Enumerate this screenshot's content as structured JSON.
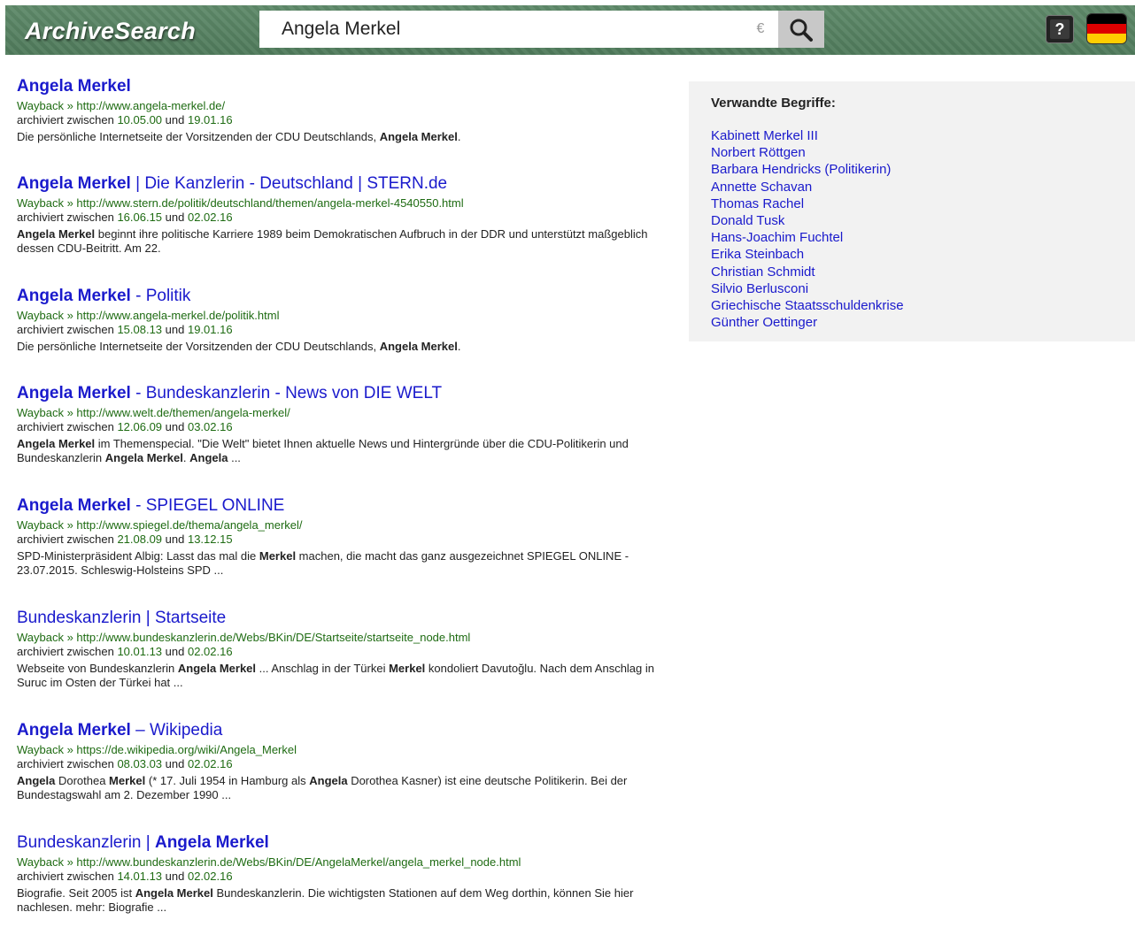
{
  "header": {
    "logo": "ArchiveSearch",
    "search_value": "Angela Merkel",
    "clear_glyph": "€",
    "help_label": "?",
    "icons": [
      "search-icon",
      "help-icon",
      "german-flag-icon"
    ],
    "flag_colors": [
      "#000000",
      "#dd0000",
      "#ffce00"
    ],
    "accent_color": "#55806a"
  },
  "results": [
    {
      "title": [
        {
          "t": "Angela Merkel",
          "b": true
        }
      ],
      "url": "Wayback » http://www.angela-merkel.de/",
      "archived_prefix": "archiviert zwischen ",
      "from": "10.05.00",
      "mid": " und ",
      "to": "19.01.16",
      "snippet": [
        {
          "t": "Die persönliche Internetseite der Vorsitzenden der CDU Deutschlands, "
        },
        {
          "t": "Angela Merkel",
          "b": true
        },
        {
          "t": "."
        }
      ]
    },
    {
      "title": [
        {
          "t": "Angela Merkel",
          "b": true
        },
        {
          "t": " | Die Kanzlerin - Deutschland | STERN.de"
        }
      ],
      "url": "Wayback » http://www.stern.de/politik/deutschland/themen/angela-merkel-4540550.html",
      "archived_prefix": "archiviert zwischen ",
      "from": "16.06.15",
      "mid": " und ",
      "to": "02.02.16",
      "snippet": [
        {
          "t": "Angela Merkel",
          "b": true
        },
        {
          "t": " beginnt ihre politische Karriere 1989 beim Demokratischen Aufbruch in der DDR und unterstützt maßgeblich dessen CDU-Beitritt. Am 22."
        }
      ]
    },
    {
      "title": [
        {
          "t": "Angela Merkel",
          "b": true
        },
        {
          "t": " - Politik"
        }
      ],
      "url": "Wayback » http://www.angela-merkel.de/politik.html",
      "archived_prefix": "archiviert zwischen ",
      "from": "15.08.13",
      "mid": " und ",
      "to": "19.01.16",
      "snippet": [
        {
          "t": "Die persönliche Internetseite der Vorsitzenden der CDU Deutschlands, "
        },
        {
          "t": "Angela Merkel",
          "b": true
        },
        {
          "t": "."
        }
      ]
    },
    {
      "title": [
        {
          "t": "Angela Merkel",
          "b": true
        },
        {
          "t": " - Bundeskanzlerin - News von DIE WELT"
        }
      ],
      "url": "Wayback » http://www.welt.de/themen/angela-merkel/",
      "archived_prefix": "archiviert zwischen ",
      "from": "12.06.09",
      "mid": " und ",
      "to": "03.02.16",
      "snippet": [
        {
          "t": "Angela Merkel",
          "b": true
        },
        {
          "t": " im Themenspecial. \"Die Welt\" bietet Ihnen aktuelle News und Hintergründe über die CDU-Politikerin und Bundeskanzlerin "
        },
        {
          "t": "Angela Merkel",
          "b": true
        },
        {
          "t": ". "
        },
        {
          "t": "Angela",
          "b": true
        },
        {
          "t": " ..."
        }
      ]
    },
    {
      "title": [
        {
          "t": "Angela Merkel",
          "b": true
        },
        {
          "t": " - SPIEGEL ONLINE"
        }
      ],
      "url": "Wayback » http://www.spiegel.de/thema/angela_merkel/",
      "archived_prefix": "archiviert zwischen ",
      "from": "21.08.09",
      "mid": " und ",
      "to": "13.12.15",
      "snippet": [
        {
          "t": "SPD-Ministerpräsident Albig: Lasst das mal die "
        },
        {
          "t": "Merkel",
          "b": true
        },
        {
          "t": " machen, die macht das ganz ausgezeichnet SPIEGEL ONLINE - 23.07.2015. Schleswig-Holsteins SPD ..."
        }
      ]
    },
    {
      "title": [
        {
          "t": "Bundeskanzlerin | Startseite"
        }
      ],
      "url": "Wayback » http://www.bundeskanzlerin.de/Webs/BKin/DE/Startseite/startseite_node.html",
      "archived_prefix": "archiviert zwischen ",
      "from": "10.01.13",
      "mid": " und ",
      "to": "02.02.16",
      "snippet": [
        {
          "t": "Webseite von Bundeskanzlerin "
        },
        {
          "t": "Angela Merkel",
          "b": true
        },
        {
          "t": " ... Anschlag in der Türkei "
        },
        {
          "t": "Merkel",
          "b": true
        },
        {
          "t": " kondoliert Davutoğlu. Nach dem Anschlag in Suruc im Osten der Türkei hat ..."
        }
      ]
    },
    {
      "title": [
        {
          "t": "Angela Merkel",
          "b": true
        },
        {
          "t": " – Wikipedia"
        }
      ],
      "url": "Wayback » https://de.wikipedia.org/wiki/Angela_Merkel",
      "archived_prefix": "archiviert zwischen ",
      "from": "08.03.03",
      "mid": " und ",
      "to": "02.02.16",
      "snippet": [
        {
          "t": "Angela",
          "b": true
        },
        {
          "t": " Dorothea "
        },
        {
          "t": "Merkel",
          "b": true
        },
        {
          "t": " (* 17. Juli 1954 in Hamburg als "
        },
        {
          "t": "Angela",
          "b": true
        },
        {
          "t": " Dorothea Kasner) ist eine deutsche Politikerin. Bei der Bundestagswahl am 2. Dezember 1990 ..."
        }
      ]
    },
    {
      "title": [
        {
          "t": "Bundeskanzlerin | "
        },
        {
          "t": "Angela Merkel",
          "b": true
        }
      ],
      "url": "Wayback » http://www.bundeskanzlerin.de/Webs/BKin/DE/AngelaMerkel/angela_merkel_node.html",
      "archived_prefix": "archiviert zwischen ",
      "from": "14.01.13",
      "mid": " und ",
      "to": "02.02.16",
      "snippet": [
        {
          "t": "Biografie. Seit 2005 ist "
        },
        {
          "t": "Angela Merkel",
          "b": true
        },
        {
          "t": " Bundeskanzlerin. Die wichtigsten Stationen auf dem Weg dorthin, können Sie hier nachlesen. mehr: Biografie ..."
        }
      ]
    }
  ],
  "sidebar": {
    "title": "Verwandte Begriffe:",
    "items": [
      "Kabinett Merkel III",
      "Norbert Röttgen",
      "Barbara Hendricks (Politikerin)",
      "Annette Schavan",
      "Thomas Rachel",
      "Donald Tusk",
      "Hans-Joachim Fuchtel",
      "Erika Steinbach",
      "Christian Schmidt",
      "Silvio Berlusconi",
      "Griechische Staatsschuldenkrise",
      "Günther Oettinger"
    ]
  }
}
